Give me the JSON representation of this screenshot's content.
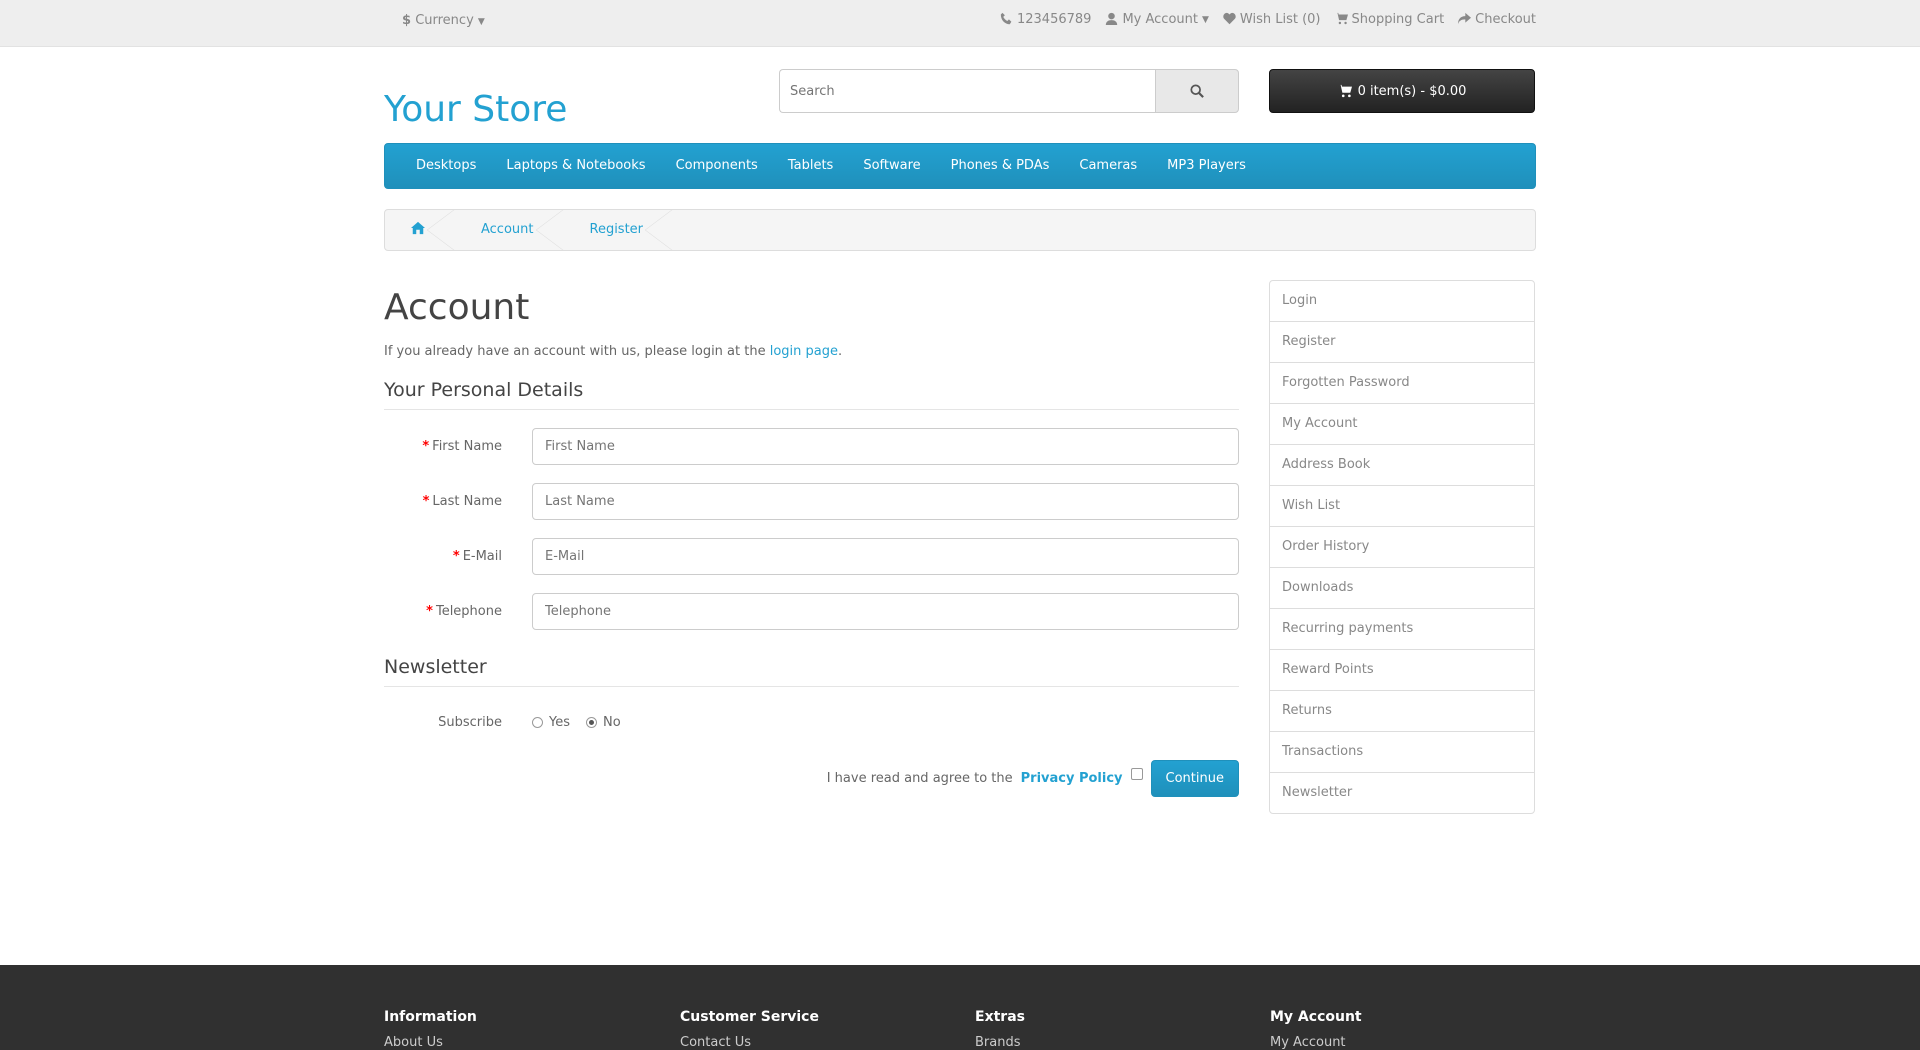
{
  "topbar": {
    "currency_symbol": "$",
    "currency_label": "Currency",
    "phone": "123456789",
    "my_account": "My Account",
    "wishlist": "Wish List (0)",
    "cart": "Shopping Cart",
    "checkout": "Checkout"
  },
  "header": {
    "logo": "Your Store",
    "search_placeholder": "Search",
    "cart_button": "0 item(s) - $0.00"
  },
  "menu": [
    "Desktops",
    "Laptops & Notebooks",
    "Components",
    "Tablets",
    "Software",
    "Phones & PDAs",
    "Cameras",
    "MP3 Players"
  ],
  "breadcrumb": [
    "Account",
    "Register"
  ],
  "content": {
    "title": "Account",
    "intro_text": "If you already have an account with us, please login at the",
    "intro_link": "login page",
    "intro_end": ".",
    "section_personal": "Your Personal Details",
    "fields": [
      {
        "label": "First Name",
        "placeholder": "First Name"
      },
      {
        "label": "Last Name",
        "placeholder": "Last Name"
      },
      {
        "label": "E-Mail",
        "placeholder": "E-Mail"
      },
      {
        "label": "Telephone",
        "placeholder": "Telephone"
      }
    ],
    "section_newsletter": "Newsletter",
    "subscribe_label": "Subscribe",
    "subscribe_yes": "Yes",
    "subscribe_no": "No",
    "subscribe_selected": "No",
    "agree_text": "I have read and agree to the",
    "privacy_policy": "Privacy Policy",
    "continue": "Continue"
  },
  "sidebar": [
    "Login",
    "Register",
    "Forgotten Password",
    "My Account",
    "Address Book",
    "Wish List",
    "Order History",
    "Downloads",
    "Recurring payments",
    "Reward Points",
    "Returns",
    "Transactions",
    "Newsletter"
  ],
  "footer": {
    "columns": [
      {
        "title": "Information",
        "first": "About Us"
      },
      {
        "title": "Customer Service",
        "first": "Contact Us"
      },
      {
        "title": "Extras",
        "first": "Brands"
      },
      {
        "title": "My Account",
        "first": "My Account"
      }
    ]
  },
  "colors": {
    "accent": "#23a1d1",
    "footer_bg": "#303030",
    "topbar_bg": "#eeeeee"
  }
}
